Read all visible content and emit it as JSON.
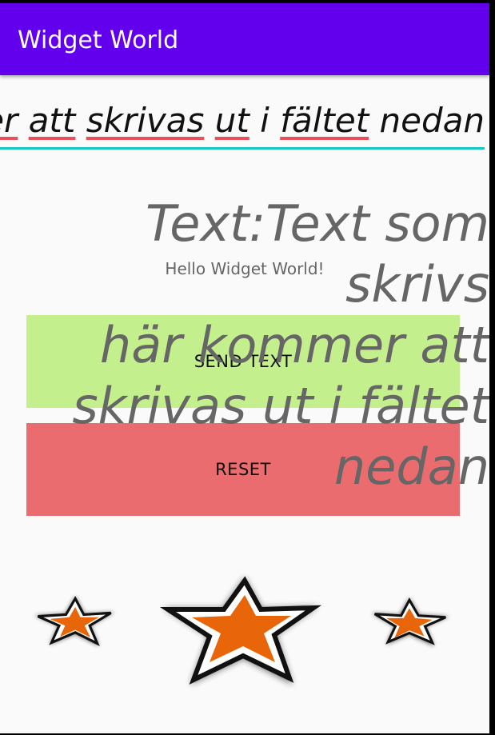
{
  "appbar": {
    "title": "Widget World"
  },
  "input": {
    "words": [
      "er",
      " ",
      "att",
      " ",
      "skrivas",
      " ",
      "ut",
      " ",
      "i",
      " ",
      "fältet",
      " ",
      "nedan"
    ]
  },
  "hello": "Hello Widget World!",
  "display": {
    "text": "Text:Text som skrivs\nhär kommer att\nskrivas ut i fältet\nnedan"
  },
  "buttons": {
    "send": "SEND TEXT",
    "reset": "RESET"
  },
  "stars": {
    "icons": [
      "star-small-icon",
      "star-large-icon",
      "star-small-icon"
    ],
    "fill_color": "#e8650a",
    "outline_color": "#111111"
  },
  "colors": {
    "appbar": "#6200ee",
    "send_button": "#c3ef8c",
    "reset_button": "#ea6c6e",
    "field_underline": "#19c6c6"
  }
}
